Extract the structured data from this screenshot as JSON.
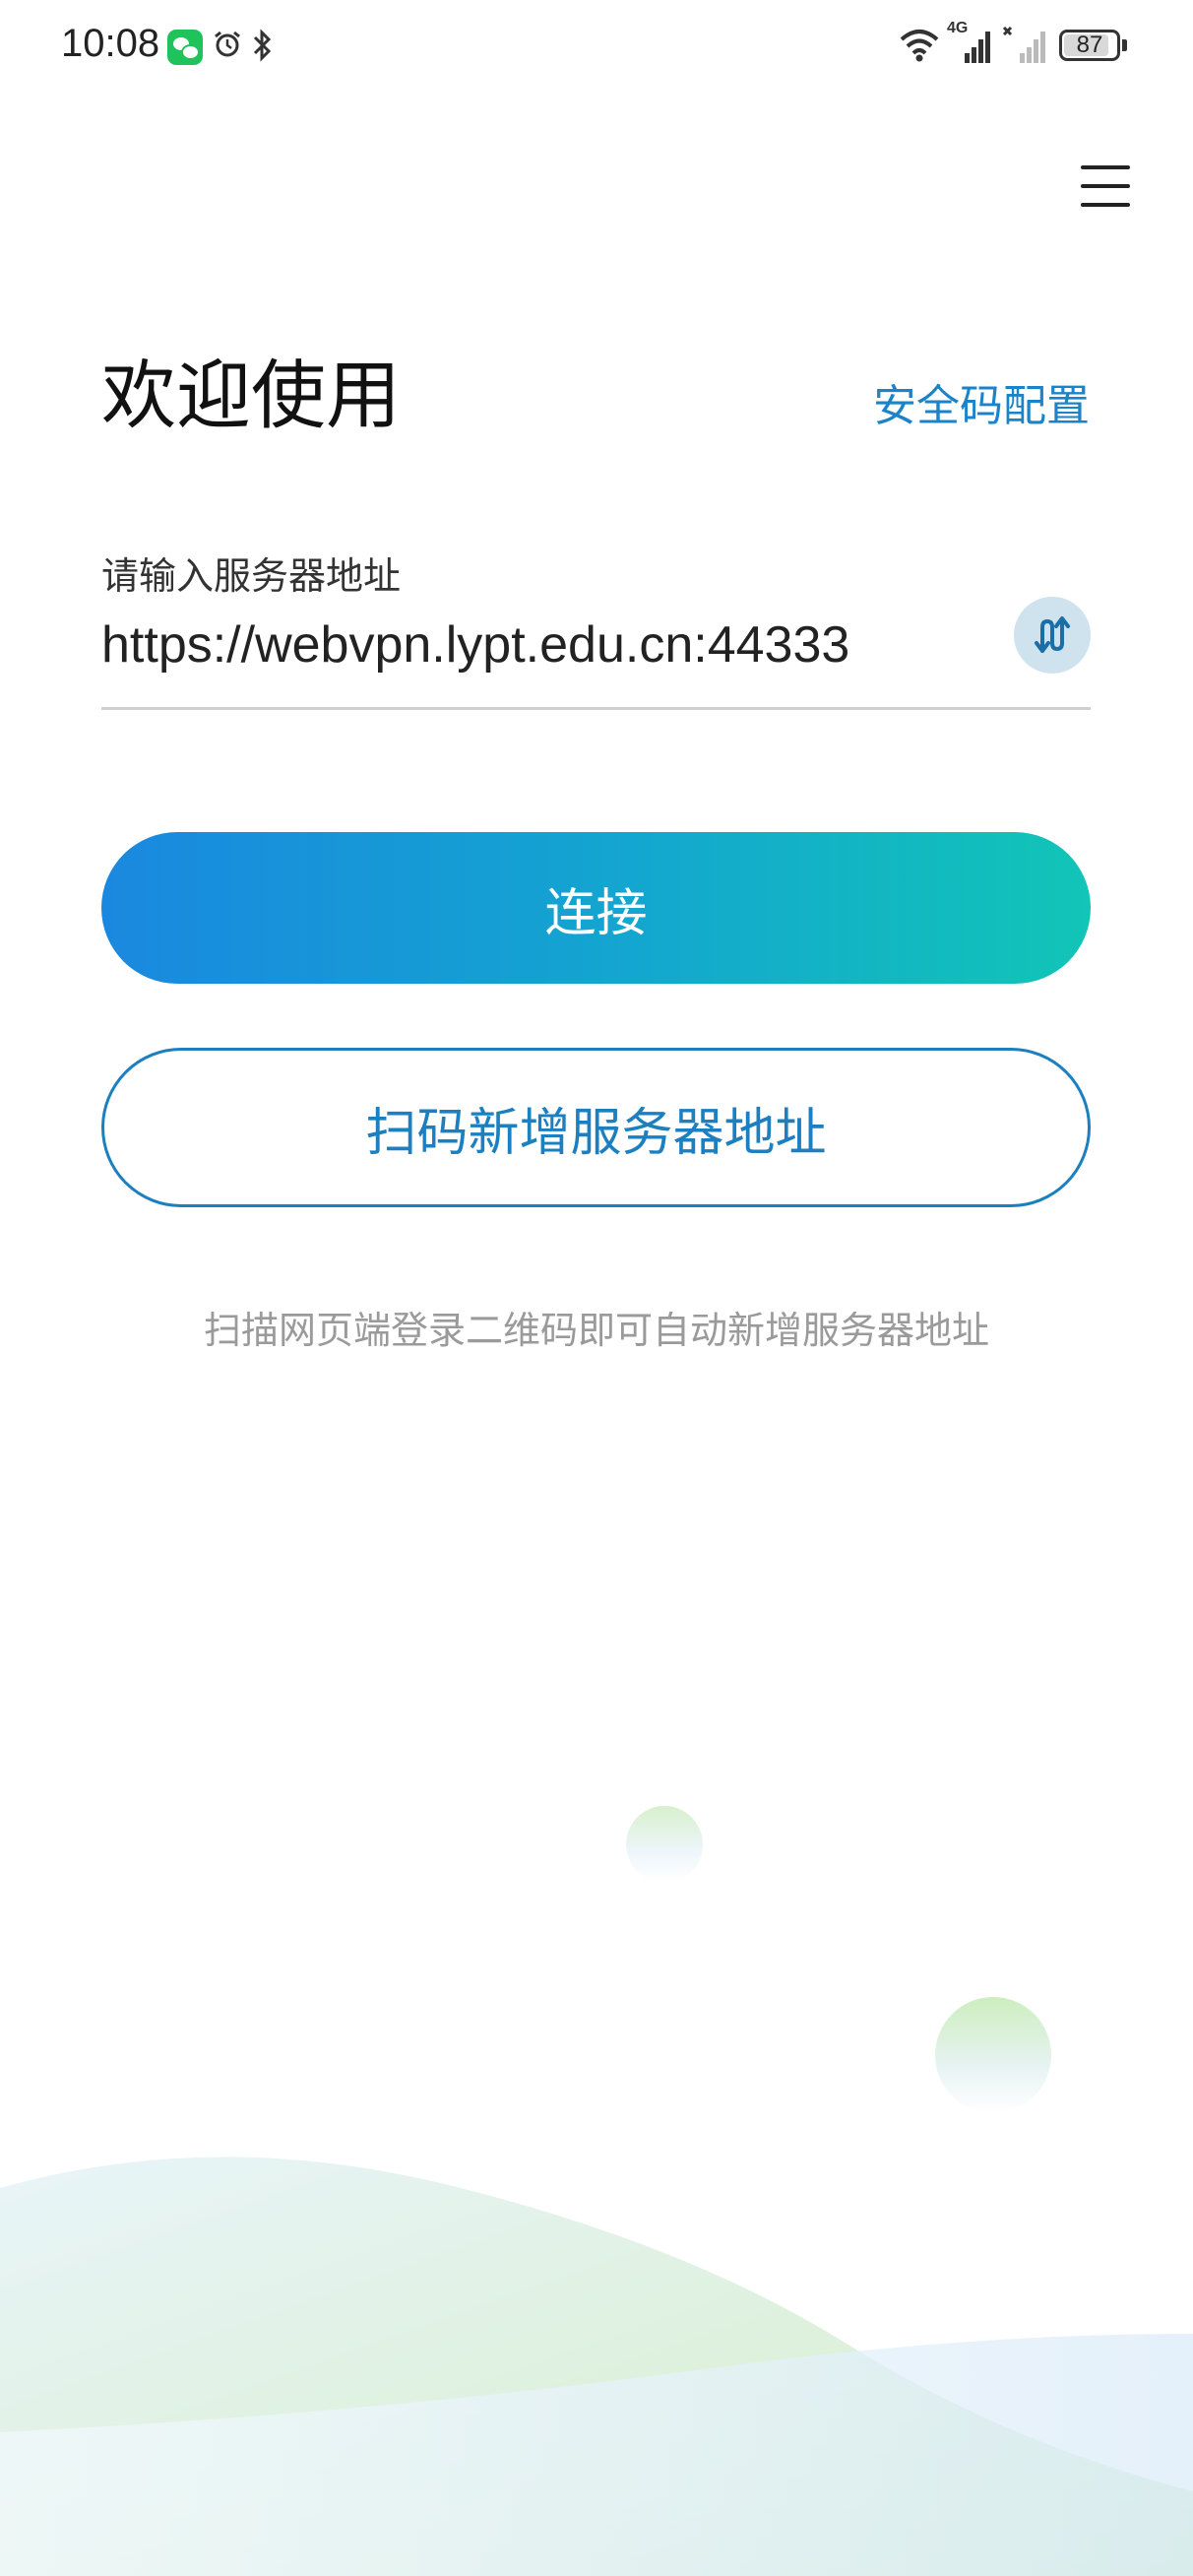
{
  "status_bar": {
    "time": "10:08",
    "battery": "87",
    "battery_level_percent": 87,
    "network_tag": "4G",
    "icons": [
      "wechat-icon",
      "alarm-icon",
      "bluetooth-icon",
      "wifi-icon",
      "signal-4g-icon",
      "signal-no-service-icon",
      "battery-icon"
    ]
  },
  "header": {
    "menu_icon": "hamburger-menu-icon"
  },
  "welcome": {
    "title": "欢迎使用",
    "security_link": "安全码配置"
  },
  "server_form": {
    "label": "请输入服务器地址",
    "value": "https://webvpn.lypt.edu.cn:44333",
    "switch_icon": "swap-arrows-icon"
  },
  "actions": {
    "connect_label": "连接",
    "scan_label": "扫码新增服务器地址"
  },
  "hint": "扫描网页端登录二维码即可自动新增服务器地址",
  "colors": {
    "accent": "#1b84c9",
    "gradient_start": "#1a88df",
    "gradient_end": "#12c5b7"
  }
}
